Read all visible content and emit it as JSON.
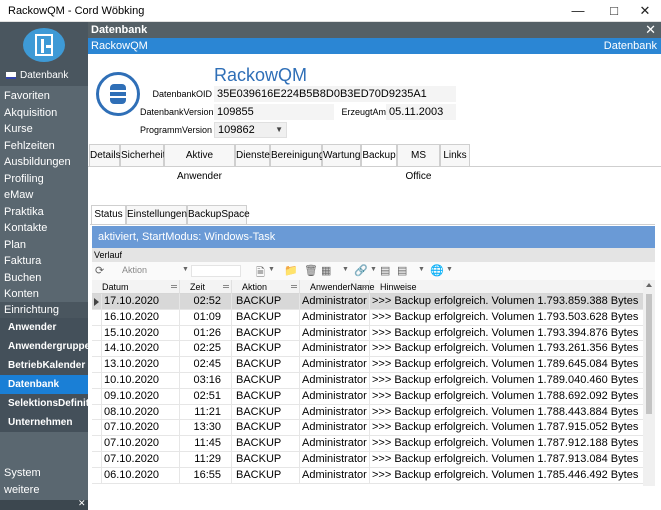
{
  "window": {
    "title": "RackowQM - Cord Wöbking"
  },
  "sidebar": {
    "db_label": "Datenbank",
    "items": [
      "Favoriten",
      "Akquisition",
      "Kurse",
      "Fehlzeiten",
      "Ausbildungen",
      "Profiling",
      "eMaw",
      "Praktika",
      "Kontakte",
      "Plan",
      "Faktura",
      "Buchen",
      "Konten"
    ],
    "section": "Einrichtung",
    "subitems": [
      "Anwender",
      "Anwendergruppen",
      "BetriebKalender",
      "Datenbank",
      "SelektionsDefinitio...",
      "Unternehmen"
    ],
    "active_subitem": "Datenbank",
    "bottom_items": [
      "System",
      "weitere"
    ]
  },
  "header": {
    "title": "Datenbank",
    "subtitle_left": "RackowQM",
    "subtitle_right": "Datenbank"
  },
  "info": {
    "app_name": "RackowQM",
    "oid_label": "DatenbankOID",
    "oid_value": "35E039616E224B5B8D0B3ED70D9235A1",
    "version_label": "DatenbankVersion",
    "version_value": "109855",
    "created_label": "ErzeugtAm",
    "created_value": "05.11.2003",
    "prog_label": "ProgrammVersion",
    "prog_value": "109862"
  },
  "tabs": [
    "Details",
    "Sicherheit",
    "Aktive Anwender",
    "Dienste",
    "Bereinigung",
    "Wartung",
    "Backup",
    "MS Office",
    "Links"
  ],
  "active_tab": "Backup",
  "subtabs": [
    "Status",
    "Einstellungen",
    "BackupSpace"
  ],
  "active_subtab": "Status",
  "status_text": "aktiviert, StartModus: Windows-Task",
  "verlauf_label": "Verlauf",
  "toolbar": {
    "action_placeholder": "Aktion"
  },
  "table": {
    "columns": [
      "Datum",
      "Zeit",
      "Aktion",
      "AnwenderName",
      "Hinweise"
    ],
    "rows": [
      [
        "17.10.2020",
        "02:52",
        "BACKUP",
        "Administrator",
        ">>> Backup erfolgreich.  Volumen 1.793.859.388 Bytes"
      ],
      [
        "16.10.2020",
        "01:09",
        "BACKUP",
        "Administrator",
        ">>> Backup erfolgreich.  Volumen 1.793.503.628 Bytes"
      ],
      [
        "15.10.2020",
        "01:26",
        "BACKUP",
        "Administrator",
        ">>> Backup erfolgreich.  Volumen 1.793.394.876 Bytes"
      ],
      [
        "14.10.2020",
        "02:25",
        "BACKUP",
        "Administrator",
        ">>> Backup erfolgreich.  Volumen 1.793.261.356 Bytes"
      ],
      [
        "13.10.2020",
        "02:45",
        "BACKUP",
        "Administrator",
        ">>> Backup erfolgreich.  Volumen 1.789.645.084 Bytes"
      ],
      [
        "10.10.2020",
        "03:16",
        "BACKUP",
        "Administrator",
        ">>> Backup erfolgreich.  Volumen 1.789.040.460 Bytes"
      ],
      [
        "09.10.2020",
        "02:51",
        "BACKUP",
        "Administrator",
        ">>> Backup erfolgreich.  Volumen 1.788.692.092 Bytes"
      ],
      [
        "08.10.2020",
        "11:21",
        "BACKUP",
        "Administrator",
        ">>> Backup erfolgreich.  Volumen 1.788.443.884 Bytes"
      ],
      [
        "07.10.2020",
        "13:30",
        "BACKUP",
        "Administrator",
        ">>> Backup erfolgreich.  Volumen 1.787.915.052 Bytes"
      ],
      [
        "07.10.2020",
        "11:45",
        "BACKUP",
        "Administrator",
        ">>> Backup erfolgreich.  Volumen 1.787.912.188 Bytes"
      ],
      [
        "07.10.2020",
        "11:29",
        "BACKUP",
        "Administrator",
        ">>> Backup erfolgreich.  Volumen 1.787.913.084 Bytes"
      ],
      [
        "06.10.2020",
        "16:55",
        "BACKUP",
        "Administrator",
        ">>> Backup erfolgreich.  Volumen 1.785.446.492 Bytes"
      ]
    ]
  },
  "colors": {
    "accent": "#2b86d4",
    "sidebar": "#5a6770",
    "active": "#1a7fd6",
    "status": "#6a9ad6"
  }
}
